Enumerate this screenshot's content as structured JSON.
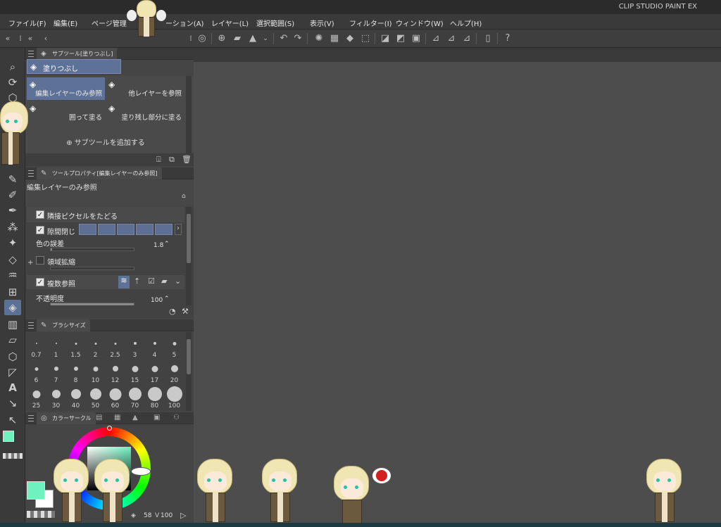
{
  "app": {
    "title": "CLIP STUDIO PAINT EX"
  },
  "menu": [
    {
      "label": "ファイル(F)"
    },
    {
      "label": "編集(E)"
    },
    {
      "label": "ページ管理"
    },
    {
      "label": "ーション(A)"
    },
    {
      "label": "レイヤー(L)"
    },
    {
      "label": "選択範囲(S)"
    },
    {
      "label": "表示(V)"
    },
    {
      "label": "フィルター(I)"
    },
    {
      "label": "ウィンドウ(W)"
    },
    {
      "label": "ヘルプ(H)"
    }
  ],
  "subtool_panel": {
    "tab_label": "サブツール[塗りつぶし]",
    "group_label": "塗りつぶし",
    "items": [
      {
        "label": "編集レイヤーのみ参照",
        "selected": true
      },
      {
        "label": "他レイヤーを参照",
        "selected": false
      },
      {
        "label": "囲って塗る",
        "selected": false
      },
      {
        "label": "塗り残し部分に塗る",
        "selected": false
      }
    ],
    "add_label": "サブツールを追加する"
  },
  "tool_property": {
    "tab_label": "ツールプロパティ[編集レイヤーのみ参照]",
    "name": "編集レイヤーのみ参照",
    "props": {
      "adjacent": {
        "label": "隣接ピクセルをたどる",
        "checked": true
      },
      "gap": {
        "label": "隙間閉じ",
        "checked": true
      },
      "tolerance": {
        "label": "色の誤差",
        "value": "1.8",
        "fraction": 0.018
      },
      "expand": {
        "label": "領域拡縮",
        "checked": false
      },
      "multi": {
        "label": "複数参照",
        "checked": true
      },
      "opacity": {
        "label": "不透明度",
        "value": "100",
        "fraction": 1.0
      }
    }
  },
  "brush_size": {
    "tab_label": "ブラシサイズ",
    "sizes": [
      "0.7",
      "1",
      "1.5",
      "2",
      "2.5",
      "3",
      "4",
      "5",
      "6",
      "7",
      "8",
      "10",
      "12",
      "15",
      "17",
      "20",
      "25",
      "30",
      "40",
      "50",
      "60",
      "70",
      "80",
      "100"
    ]
  },
  "color_panel": {
    "tab_label": "カラーサークル",
    "h_value": "58",
    "v_value": "100",
    "main_color": "#6ef2c0",
    "sub_color": "#ffffff"
  }
}
